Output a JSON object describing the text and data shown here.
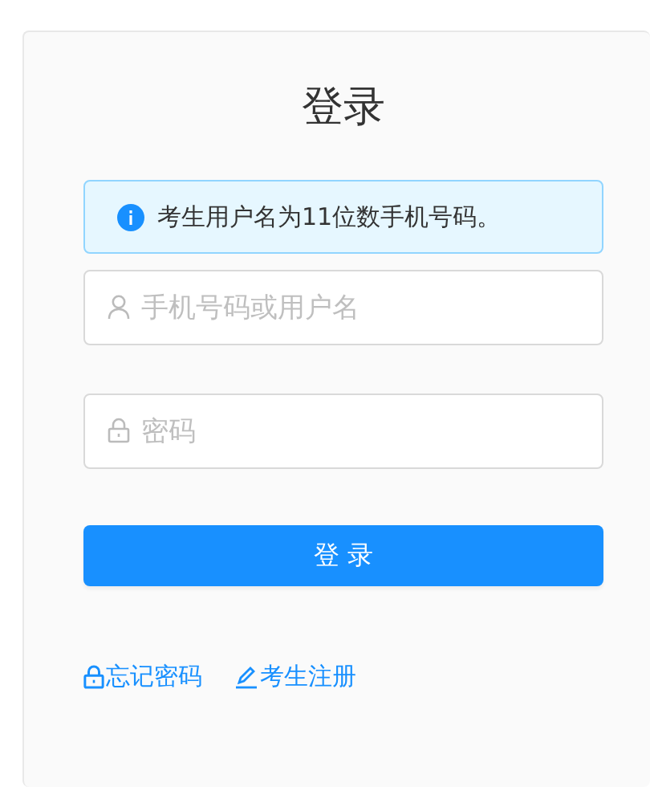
{
  "title": "登录",
  "notice": {
    "text": "考生用户名为11位数手机号码。"
  },
  "fields": [
    {
      "placeholder": "手机号码或用户名"
    },
    {
      "placeholder": "密码"
    }
  ],
  "submit": {
    "label": "登 录"
  },
  "links": [
    {
      "label": "忘记密码"
    },
    {
      "label": "考生注册"
    }
  ]
}
